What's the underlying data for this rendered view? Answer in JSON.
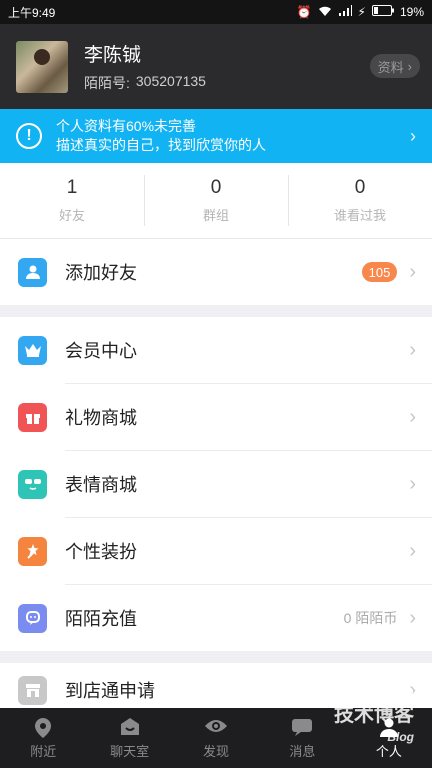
{
  "statusbar": {
    "time": "上午9:49",
    "battery": "19%"
  },
  "profile": {
    "name": "李陈铖",
    "id_label": "陌陌号:",
    "id_value": "305207135",
    "info_button": "资料"
  },
  "banner": {
    "line1": "个人资料有60%未完善",
    "line2": "描述真实的自己，找到欣赏你的人",
    "color": "#12b3f2"
  },
  "stats": [
    {
      "num": "1",
      "label": "好友"
    },
    {
      "num": "0",
      "label": "群组"
    },
    {
      "num": "0",
      "label": "谁看过我"
    }
  ],
  "rows": {
    "add_friend": {
      "label": "添加好友",
      "badge": "105",
      "color": "#33a7f0"
    },
    "vip": {
      "label": "会员中心",
      "color": "#33a7f0"
    },
    "gift": {
      "label": "礼物商城",
      "color": "#f05454"
    },
    "emoji": {
      "label": "表情商城",
      "color": "#2ec4b6"
    },
    "dress": {
      "label": "个性装扮",
      "color": "#f5843e"
    },
    "recharge": {
      "label": "陌陌充值",
      "value": "0 陌陌币",
      "color": "#7b8cf0"
    },
    "store": {
      "label": "到店通申请",
      "color": "#c8c8c8"
    }
  },
  "tabs": [
    {
      "label": "附近",
      "icon": "location-icon"
    },
    {
      "label": "聊天室",
      "icon": "chatroom-icon"
    },
    {
      "label": "发现",
      "icon": "eye-icon"
    },
    {
      "label": "消息",
      "icon": "message-icon"
    },
    {
      "label": "个人",
      "icon": "person-icon",
      "active": true
    }
  ],
  "watermark": {
    "line1": "51CTO.com",
    "line2": "技术博客",
    "line3": "Blog"
  }
}
